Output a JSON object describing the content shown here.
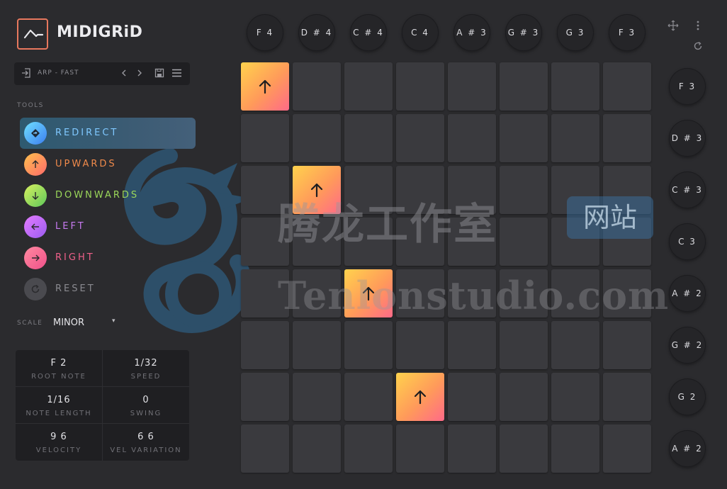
{
  "app": {
    "brand": "MIDIGRiD"
  },
  "preset": {
    "name": "ARP - FAST"
  },
  "tools": {
    "section_label": "TOOLS",
    "items": [
      {
        "label": "REDIRECT",
        "icon": "redirect-icon",
        "color": "#7fc8ff",
        "selected": true
      },
      {
        "label": "UPWARDS",
        "icon": "arrow-up-icon",
        "color": "#f08a4b",
        "selected": false
      },
      {
        "label": "DOWNWARDS",
        "icon": "arrow-down-icon",
        "color": "#9bd75a",
        "selected": false
      },
      {
        "label": "LEFT",
        "icon": "arrow-left-icon",
        "color": "#c77af0",
        "selected": false
      },
      {
        "label": "RIGHT",
        "icon": "arrow-right-icon",
        "color": "#f0608a",
        "selected": false
      },
      {
        "label": "RESET",
        "icon": "reset-icon",
        "color": "#8a8a90",
        "selected": false
      }
    ]
  },
  "scale": {
    "label": "SCALE",
    "value": "MINOR"
  },
  "params": [
    {
      "value": "F 2",
      "label": "ROOT NOTE"
    },
    {
      "value": "1/32",
      "label": "SPEED"
    },
    {
      "value": "1/16",
      "label": "NOTE LENGTH"
    },
    {
      "value": "0",
      "label": "SWING"
    },
    {
      "value": "9 6",
      "label": "VELOCITY"
    },
    {
      "value": "6 6",
      "label": "VEL VARIATION"
    }
  ],
  "top_notes": [
    "F 4",
    "D # 4",
    "C # 4",
    "C 4",
    "A # 3",
    "G # 3",
    "G 3",
    "F 3"
  ],
  "side_notes": [
    "F 3",
    "D # 3",
    "C # 3",
    "C 3",
    "A # 2",
    "G # 2",
    "G 2",
    "A # 2"
  ],
  "grid": {
    "active_cells": [
      {
        "row": 0,
        "col": 0,
        "direction": "up"
      },
      {
        "row": 2,
        "col": 1,
        "direction": "up"
      },
      {
        "row": 4,
        "col": 2,
        "direction": "up"
      },
      {
        "row": 6,
        "col": 3,
        "direction": "up"
      }
    ]
  },
  "watermark": {
    "cn": "腾龙工作室",
    "cn_box": "网站",
    "en": "Tenlonstudio.com"
  },
  "colors": {
    "accent": "#e8785e",
    "background": "#2b2b2e",
    "cell": "#3a3a3e",
    "active_gradient": [
      "#ffd24d",
      "#ff9a5a",
      "#ff6a88"
    ]
  }
}
